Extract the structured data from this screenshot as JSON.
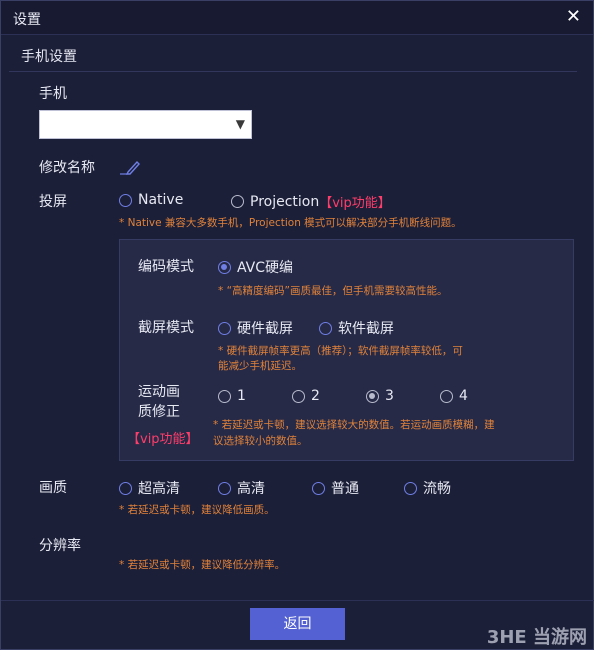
{
  "window": {
    "title": "设置"
  },
  "section": {
    "title": "手机设置"
  },
  "phone": {
    "label": "手机",
    "select_value": ""
  },
  "rename": {
    "label": "修改名称"
  },
  "cast": {
    "label": "投屏",
    "options": [
      "Native",
      "Projection"
    ],
    "vip": "【vip功能】",
    "note": "* Native 兼容大多数手机，Projection 模式可以解决部分手机断线问题。"
  },
  "encode": {
    "label": "编码模式",
    "option": "AVC硬编",
    "note": "* “高精度编码”画质最佳，但手机需要较高性能。"
  },
  "capture": {
    "label": "截屏模式",
    "options": [
      "硬件截屏",
      "软件截屏"
    ],
    "note_line1": "* 硬件截屏帧率更高（推荐）；软件截屏帧率较低，可",
    "note_line2": "能减少手机延迟。"
  },
  "motion": {
    "label_line1": "运动画",
    "label_line2": "质修正",
    "vip": "【vip功能】",
    "options": [
      "1",
      "2",
      "3",
      "4"
    ],
    "note_line1": "* 若延迟或卡顿，建议选择较大的数值。若运动画质模糊，建",
    "note_line2": "议选择较小的数值。"
  },
  "quality": {
    "label": "画质",
    "options": [
      "超高清",
      "高清",
      "普通",
      "流畅"
    ],
    "note": "* 若延迟或卡顿，建议降低画质。"
  },
  "resolution": {
    "label": "分辨率",
    "note": "* 若延迟或卡顿，建议降低分辨率。"
  },
  "footer": {
    "back_label": "返回"
  },
  "watermark": {
    "text": "3HE 当游网"
  }
}
